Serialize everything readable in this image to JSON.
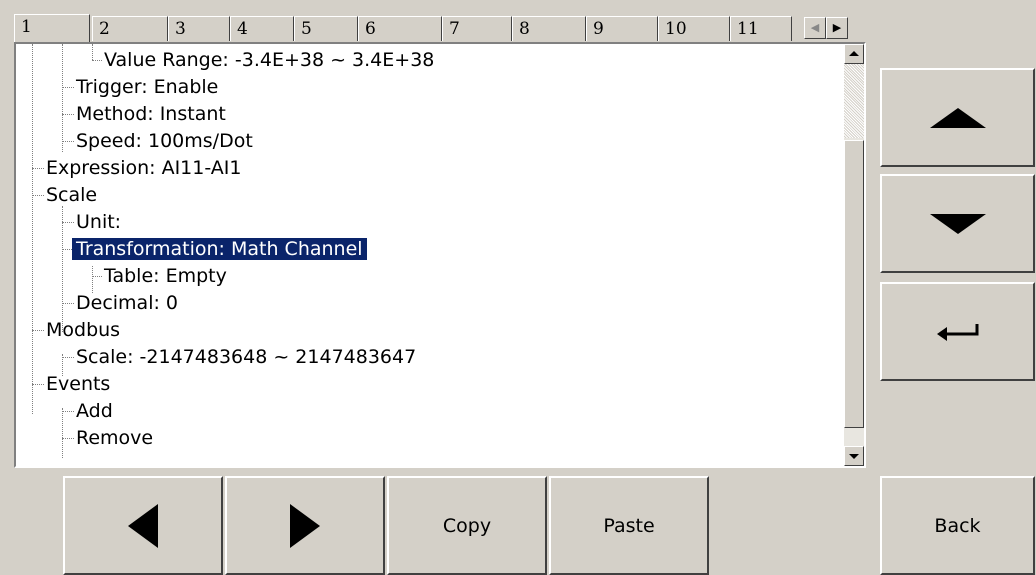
{
  "tabs": [
    "1",
    "2",
    "3",
    "4",
    "5",
    "6",
    "7",
    "8",
    "9",
    "10",
    "11"
  ],
  "active_tab": "1",
  "tree": [
    {
      "label": "Value Range: -3.4E+38  ~ 3.4E+38",
      "level": 3
    },
    {
      "label": "Trigger: Enable",
      "level": 2
    },
    {
      "label": "Method: Instant",
      "level": 2
    },
    {
      "label": "Speed: 100ms/Dot",
      "level": 2
    },
    {
      "label": "Expression: AI11-AI1",
      "level": 1
    },
    {
      "label": "Scale",
      "level": 1
    },
    {
      "label": "Unit:",
      "level": 2
    },
    {
      "label": "Transformation: Math Channel",
      "level": 2,
      "selected": true
    },
    {
      "label": "Table: Empty",
      "level": 3
    },
    {
      "label": "Decimal: 0",
      "level": 2
    },
    {
      "label": "Modbus",
      "level": 1
    },
    {
      "label": "Scale: -2147483648 ~ 2147483647",
      "level": 2
    },
    {
      "label": "Events",
      "level": 1
    },
    {
      "label": "Add",
      "level": 2
    },
    {
      "label": "Remove",
      "level": 2
    }
  ],
  "buttons": {
    "up_icon": "arrow-up",
    "down_icon": "arrow-down",
    "enter_icon": "enter",
    "left_icon": "arrow-left",
    "right_icon": "arrow-right",
    "copy": "Copy",
    "paste": "Paste",
    "back": "Back"
  },
  "colors": {
    "selection": "#0a246a",
    "background": "#d4d0c8"
  }
}
